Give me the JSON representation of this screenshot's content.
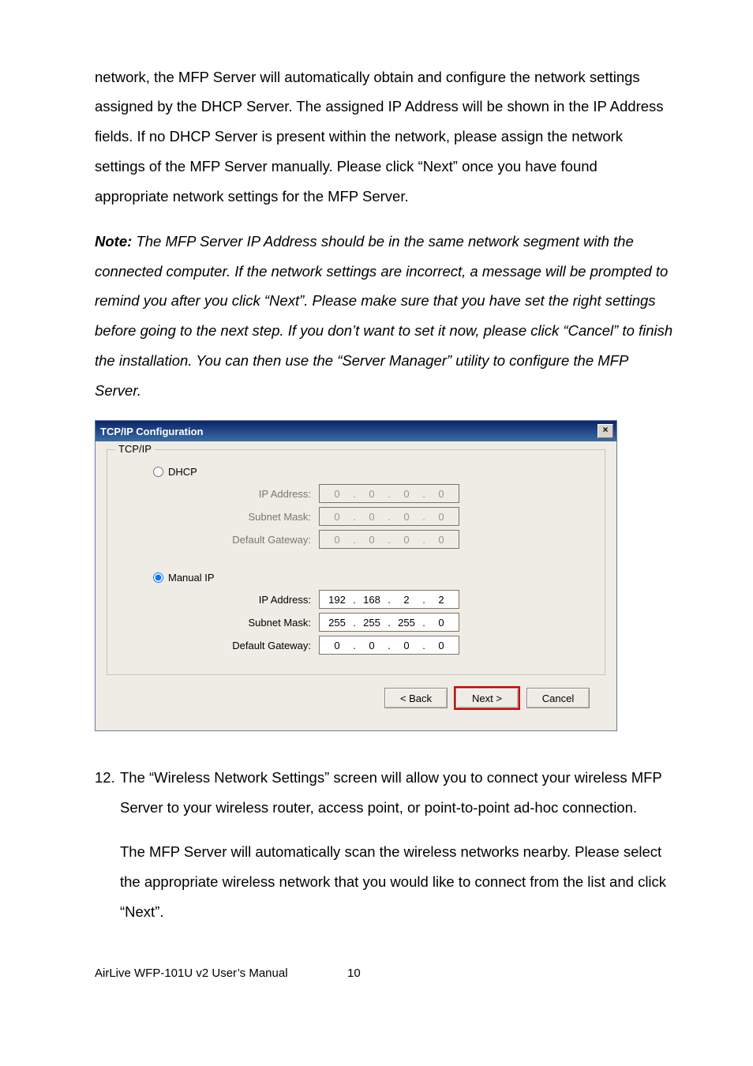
{
  "para1": "network, the MFP Server will automatically obtain and configure the network settings assigned by the DHCP Server. The assigned IP Address will be shown in the IP Address fields. If no DHCP Server is present within the network, please assign the network settings of the MFP Server manually. Please click “Next” once you have found appropriate network settings for the MFP Server.",
  "note_label": "Note:",
  "note_body": " The MFP Server IP Address should be in the same network segment with the connected computer. If the network settings are incorrect, a message will be prompted to remind you after you click “Next”. Please make sure that you have set the right settings before going to the next step. If you don’t want to set it now, please click “Cancel” to finish the installation. You can then use the “Server Manager” utility to configure the MFP Server.",
  "dialog": {
    "title": "TCP/IP Configuration",
    "close": "×",
    "group_legend": "TCP/IP",
    "dhcp_label": "DHCP",
    "manual_label": "Manual IP",
    "lbl_ip": "IP Address:",
    "lbl_mask": "Subnet Mask:",
    "lbl_gw": "Default Gateway:",
    "dhcp_ip": [
      "0",
      "0",
      "0",
      "0"
    ],
    "dhcp_mask": [
      "0",
      "0",
      "0",
      "0"
    ],
    "dhcp_gw": [
      "0",
      "0",
      "0",
      "0"
    ],
    "man_ip": [
      "192",
      "168",
      "2",
      "2"
    ],
    "man_mask": [
      "255",
      "255",
      "255",
      "0"
    ],
    "man_gw": [
      "0",
      "0",
      "0",
      "0"
    ],
    "btn_back": "< Back",
    "btn_next": "Next >",
    "btn_cancel": "Cancel"
  },
  "step12_num": "12.",
  "step12_text": "The “Wireless Network Settings” screen will allow you to connect your wireless MFP Server to your wireless router, access point, or point-to-point ad-hoc connection.",
  "step12_cont": "The MFP Server will automatically scan the wireless networks nearby. Please select the appropriate wireless network that you would like to connect from the list and click “Next”.",
  "footer_left": "AirLive WFP-101U v2 User’s Manual",
  "footer_page": "10"
}
